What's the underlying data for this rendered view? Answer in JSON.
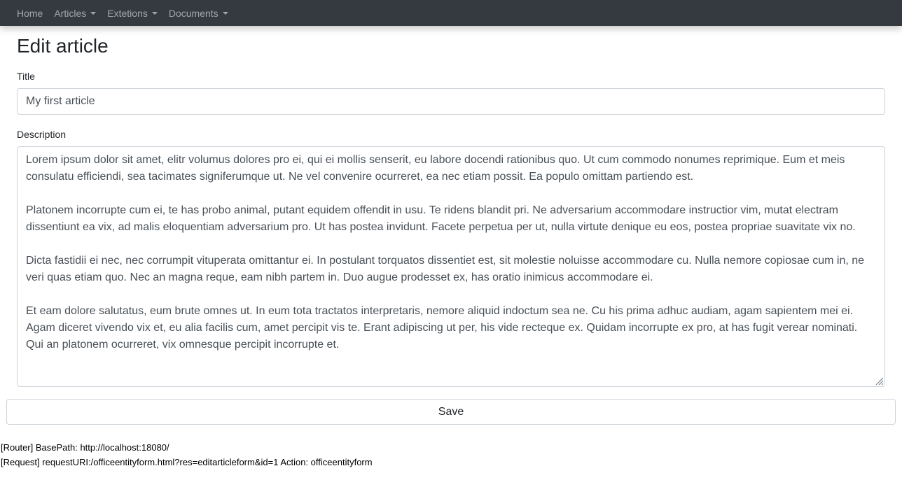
{
  "navbar": {
    "items": [
      {
        "label": "Home",
        "dropdown": false
      },
      {
        "label": "Articles",
        "dropdown": true
      },
      {
        "label": "Extetions",
        "dropdown": true
      },
      {
        "label": "Documents",
        "dropdown": true
      }
    ]
  },
  "page": {
    "title": "Edit article"
  },
  "form": {
    "title_label": "Title",
    "title_value": "My first article",
    "description_label": "Description",
    "description_paragraphs": [
      "Lorem ipsum dolor sit amet, elitr volumus dolores pro ei, qui ei mollis senserit, eu labore docendi rationibus quo. Ut cum commodo nonumes reprimique. Eum et meis consulatu efficiendi, sea tacimates signiferumque ut. Ne vel convenire ocurreret, ea nec etiam possit. Ea populo omittam partiendo est.",
      "Platonem incorrupte cum ei, te has probo animal, putant equidem offendit in usu. Te ridens blandit pri. Ne adversarium accommodare instructior vim, mutat electram dissentiunt ea vix, ad malis eloquentiam adversarium pro. Ut has postea invidunt. Facete perpetua per ut, nulla virtute denique eu eos, postea propriae suavitate vix no.",
      "Dicta fastidii ei nec, nec corrumpit vituperata omittantur ei. In postulant torquatos dissentiet est, sit molestie noluisse accommodare cu. Nulla nemore copiosae cum in, ne veri quas etiam quo. Nec an magna reque, eam nibh partem in. Duo augue prodesset ex, has oratio inimicus accommodare ei.",
      "Et eam dolore salutatus, eum brute omnes ut. In eum tota tractatos interpretaris, nemore aliquid indoctum sea ne. Cu his prima adhuc audiam, agam sapientem mei ei. Agam diceret vivendo vix et, eu alia facilis cum, amet percipit vis te. Erant adipiscing ut per, his vide recteque ex. Quidam incorrupte ex pro, at has fugit verear nominati. Qui an platonem ocurreret, vix omnesque percipit incorrupte et."
    ],
    "save_label": "Save"
  },
  "debug": {
    "router_line": "[Router] BasePath: http://localhost:18080/",
    "request_line": "[Request] requestURI:/officeentityform.html?res=editarticleform&id=1 Action: officeentityform"
  },
  "colors": {
    "navbar_bg": "#343a40",
    "nav_text": "rgba(255,255,255,0.55)",
    "input_border": "#ced4da",
    "input_text": "#495057"
  },
  "icons": {
    "dropdown": "caret-down-icon",
    "resize": "resize-grip-icon"
  }
}
